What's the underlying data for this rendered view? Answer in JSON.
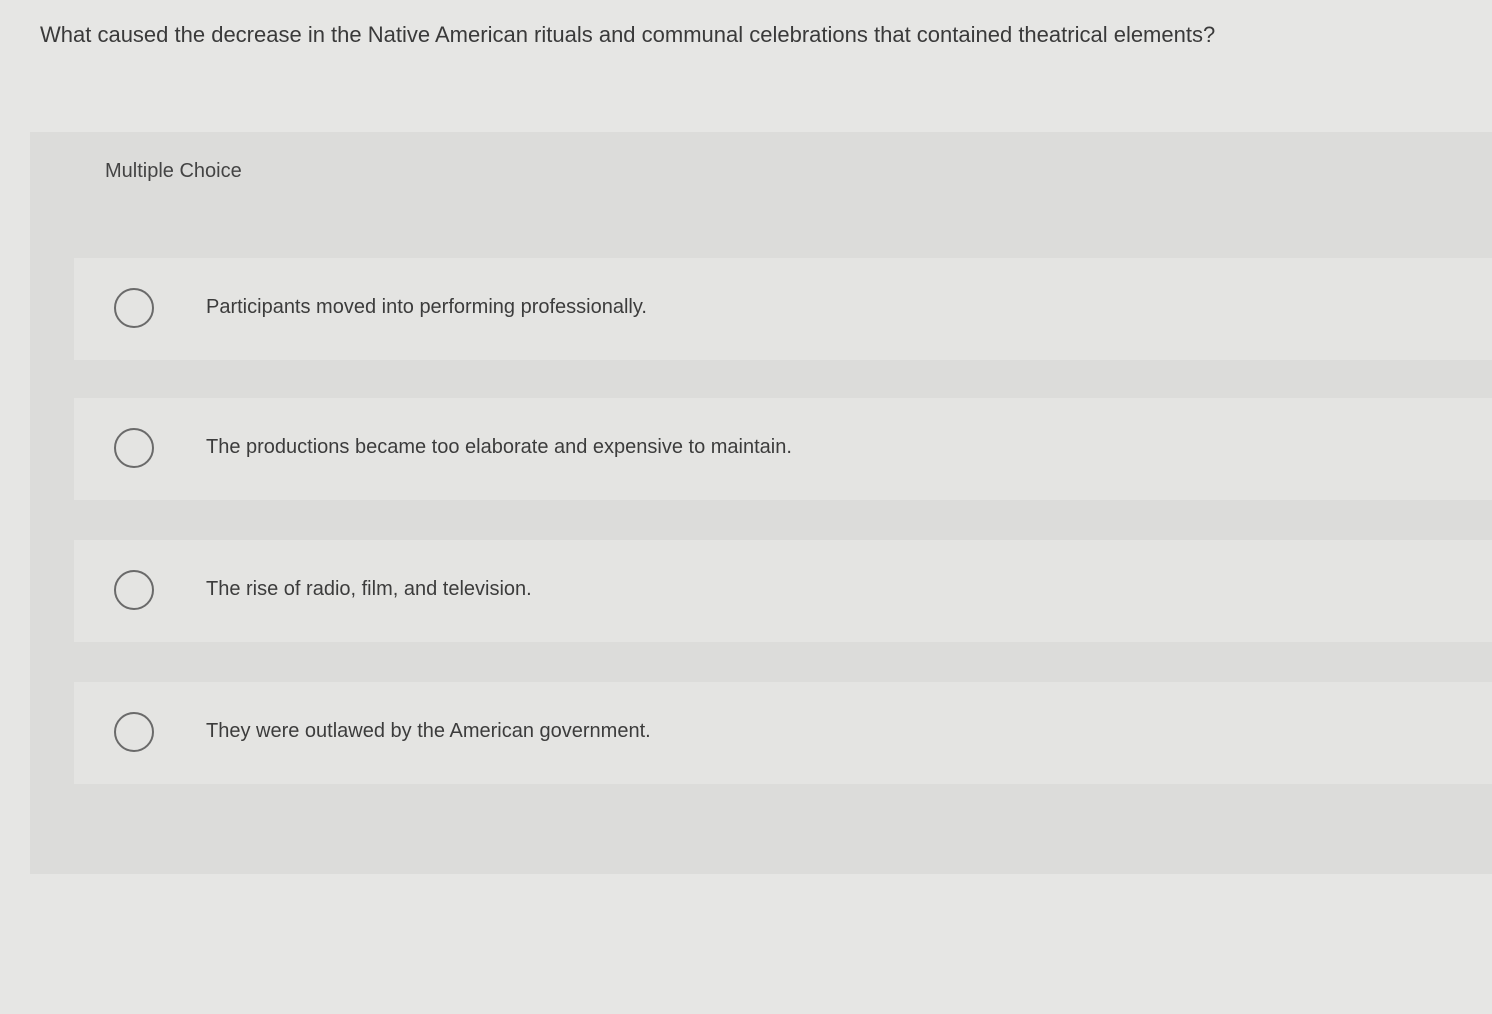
{
  "question": {
    "text": "What caused the decrease in the Native American rituals and communal celebrations that contained theatrical elements?"
  },
  "panel": {
    "label": "Multiple Choice"
  },
  "options": [
    {
      "label": "Participants moved into performing professionally."
    },
    {
      "label": "The productions became too elaborate and expensive to maintain."
    },
    {
      "label": "The rise of radio, film, and television."
    },
    {
      "label": "They were outlawed by the American government."
    }
  ]
}
